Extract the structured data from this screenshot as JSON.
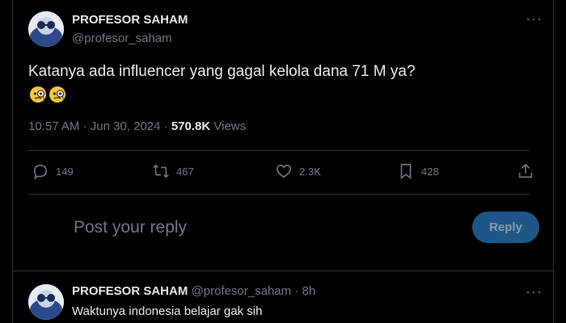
{
  "tweet": {
    "author_name": "PROFESOR SAHAM",
    "author_handle": "@profesor_saham",
    "text": "Katanya ada influencer yang gagal kelola dana 71 M ya?",
    "emojis": [
      "face-with-monocle",
      "face-with-monocle"
    ],
    "time": "10:57 AM",
    "separator": "·",
    "date": "Jun 30, 2024",
    "views_count": "570.8K",
    "views_label": "Views",
    "more": "···"
  },
  "actions": {
    "replies": "149",
    "retweets": "467",
    "likes": "2.3K",
    "bookmarks": "428"
  },
  "composer": {
    "placeholder": "Post your reply",
    "button_label": "Reply",
    "button_color": "#1e5787"
  },
  "reply": {
    "author_name": "PROFESOR SAHAM",
    "author_handle": "@profesor_saham",
    "separator": "·",
    "age": "8h",
    "text": "Waktunya indonesia belajar gak sih",
    "more": "···"
  },
  "colors": {
    "background": "#000000",
    "text": "#e7e9ea",
    "muted": "#71767b",
    "border": "#2f3336"
  }
}
